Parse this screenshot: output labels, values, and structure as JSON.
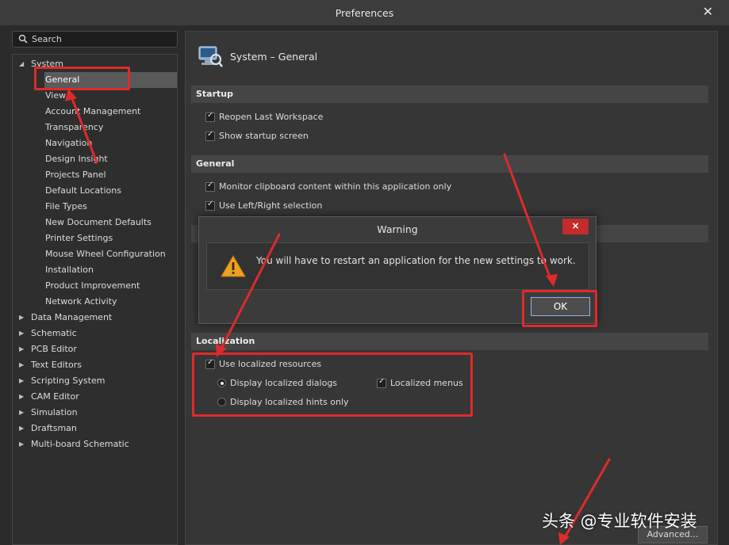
{
  "window": {
    "title": "Preferences"
  },
  "search": {
    "label": "Search"
  },
  "tree": [
    {
      "label": "System",
      "level": 0,
      "expanded": true
    },
    {
      "label": "General",
      "level": 1,
      "selected": true
    },
    {
      "label": "View",
      "level": 1
    },
    {
      "label": "Account Management",
      "level": 1
    },
    {
      "label": "Transparency",
      "level": 1
    },
    {
      "label": "Navigation",
      "level": 1
    },
    {
      "label": "Design Insight",
      "level": 1
    },
    {
      "label": "Projects Panel",
      "level": 1
    },
    {
      "label": "Default Locations",
      "level": 1
    },
    {
      "label": "File Types",
      "level": 1
    },
    {
      "label": "New Document Defaults",
      "level": 1
    },
    {
      "label": "Printer Settings",
      "level": 1
    },
    {
      "label": "Mouse Wheel Configuration",
      "level": 1
    },
    {
      "label": "Installation",
      "level": 1
    },
    {
      "label": "Product Improvement",
      "level": 1
    },
    {
      "label": "Network Activity",
      "level": 1
    },
    {
      "label": "Data Management",
      "level": 0,
      "expanded": false
    },
    {
      "label": "Schematic",
      "level": 0,
      "expanded": false
    },
    {
      "label": "PCB Editor",
      "level": 0,
      "expanded": false
    },
    {
      "label": "Text Editors",
      "level": 0,
      "expanded": false
    },
    {
      "label": "Scripting System",
      "level": 0,
      "expanded": false
    },
    {
      "label": "CAM Editor",
      "level": 0,
      "expanded": false
    },
    {
      "label": "Simulation",
      "level": 0,
      "expanded": false
    },
    {
      "label": "Draftsman",
      "level": 0,
      "expanded": false
    },
    {
      "label": "Multi-board Schematic",
      "level": 0,
      "expanded": false
    }
  ],
  "page": {
    "title": "System – General"
  },
  "startup": {
    "header": "Startup",
    "reopen": "Reopen Last Workspace",
    "show_startup": "Show startup screen"
  },
  "general": {
    "header": "General",
    "monitor_clipboard": "Monitor clipboard content within this application only",
    "left_right": "Use Left/Right selection"
  },
  "localization": {
    "header": "Localization",
    "use_localized": "Use localized resources",
    "dialogs": "Display localized dialogs",
    "menus": "Localized menus",
    "hints": "Display localized hints only"
  },
  "advanced_button": "Advanced...",
  "dialog": {
    "title": "Warning",
    "close": "×",
    "message": "You will have to restart an application for the new settings to work.",
    "ok": "OK"
  },
  "watermark": "头条 @专业软件安装",
  "colors": {
    "highlight": "#e02a2a",
    "warning_icon": "#f0a020",
    "close_button": "#c42b2b"
  },
  "icons": [
    "search-icon",
    "preferences-icon",
    "warning-icon",
    "close-icon",
    "expand-arrow-icon",
    "collapse-arrow-icon"
  ]
}
